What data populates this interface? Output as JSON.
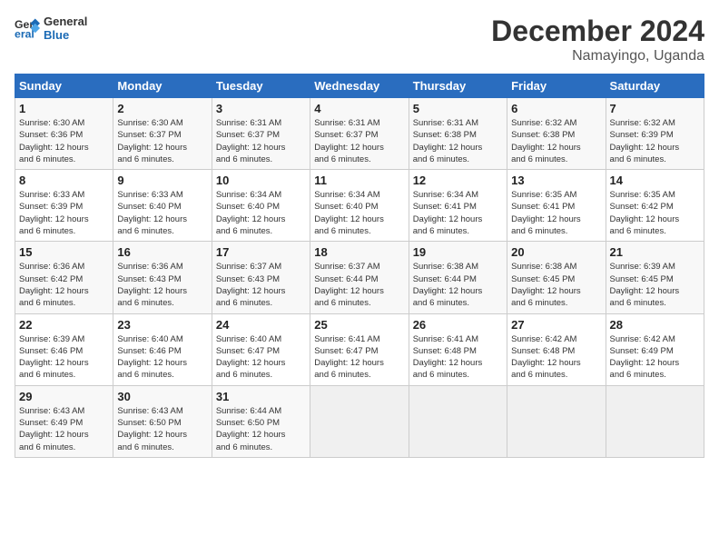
{
  "logo": {
    "line1": "General",
    "line2": "Blue"
  },
  "title": "December 2024",
  "subtitle": "Namayingo, Uganda",
  "days_of_week": [
    "Sunday",
    "Monday",
    "Tuesday",
    "Wednesday",
    "Thursday",
    "Friday",
    "Saturday"
  ],
  "weeks": [
    [
      {
        "day": "1",
        "sunrise": "6:30 AM",
        "sunset": "6:36 PM",
        "daylight": "12 hours and 6 minutes."
      },
      {
        "day": "2",
        "sunrise": "6:30 AM",
        "sunset": "6:37 PM",
        "daylight": "12 hours and 6 minutes."
      },
      {
        "day": "3",
        "sunrise": "6:31 AM",
        "sunset": "6:37 PM",
        "daylight": "12 hours and 6 minutes."
      },
      {
        "day": "4",
        "sunrise": "6:31 AM",
        "sunset": "6:37 PM",
        "daylight": "12 hours and 6 minutes."
      },
      {
        "day": "5",
        "sunrise": "6:31 AM",
        "sunset": "6:38 PM",
        "daylight": "12 hours and 6 minutes."
      },
      {
        "day": "6",
        "sunrise": "6:32 AM",
        "sunset": "6:38 PM",
        "daylight": "12 hours and 6 minutes."
      },
      {
        "day": "7",
        "sunrise": "6:32 AM",
        "sunset": "6:39 PM",
        "daylight": "12 hours and 6 minutes."
      }
    ],
    [
      {
        "day": "8",
        "sunrise": "6:33 AM",
        "sunset": "6:39 PM",
        "daylight": "12 hours and 6 minutes."
      },
      {
        "day": "9",
        "sunrise": "6:33 AM",
        "sunset": "6:40 PM",
        "daylight": "12 hours and 6 minutes."
      },
      {
        "day": "10",
        "sunrise": "6:34 AM",
        "sunset": "6:40 PM",
        "daylight": "12 hours and 6 minutes."
      },
      {
        "day": "11",
        "sunrise": "6:34 AM",
        "sunset": "6:40 PM",
        "daylight": "12 hours and 6 minutes."
      },
      {
        "day": "12",
        "sunrise": "6:34 AM",
        "sunset": "6:41 PM",
        "daylight": "12 hours and 6 minutes."
      },
      {
        "day": "13",
        "sunrise": "6:35 AM",
        "sunset": "6:41 PM",
        "daylight": "12 hours and 6 minutes."
      },
      {
        "day": "14",
        "sunrise": "6:35 AM",
        "sunset": "6:42 PM",
        "daylight": "12 hours and 6 minutes."
      }
    ],
    [
      {
        "day": "15",
        "sunrise": "6:36 AM",
        "sunset": "6:42 PM",
        "daylight": "12 hours and 6 minutes."
      },
      {
        "day": "16",
        "sunrise": "6:36 AM",
        "sunset": "6:43 PM",
        "daylight": "12 hours and 6 minutes."
      },
      {
        "day": "17",
        "sunrise": "6:37 AM",
        "sunset": "6:43 PM",
        "daylight": "12 hours and 6 minutes."
      },
      {
        "day": "18",
        "sunrise": "6:37 AM",
        "sunset": "6:44 PM",
        "daylight": "12 hours and 6 minutes."
      },
      {
        "day": "19",
        "sunrise": "6:38 AM",
        "sunset": "6:44 PM",
        "daylight": "12 hours and 6 minutes."
      },
      {
        "day": "20",
        "sunrise": "6:38 AM",
        "sunset": "6:45 PM",
        "daylight": "12 hours and 6 minutes."
      },
      {
        "day": "21",
        "sunrise": "6:39 AM",
        "sunset": "6:45 PM",
        "daylight": "12 hours and 6 minutes."
      }
    ],
    [
      {
        "day": "22",
        "sunrise": "6:39 AM",
        "sunset": "6:46 PM",
        "daylight": "12 hours and 6 minutes."
      },
      {
        "day": "23",
        "sunrise": "6:40 AM",
        "sunset": "6:46 PM",
        "daylight": "12 hours and 6 minutes."
      },
      {
        "day": "24",
        "sunrise": "6:40 AM",
        "sunset": "6:47 PM",
        "daylight": "12 hours and 6 minutes."
      },
      {
        "day": "25",
        "sunrise": "6:41 AM",
        "sunset": "6:47 PM",
        "daylight": "12 hours and 6 minutes."
      },
      {
        "day": "26",
        "sunrise": "6:41 AM",
        "sunset": "6:48 PM",
        "daylight": "12 hours and 6 minutes."
      },
      {
        "day": "27",
        "sunrise": "6:42 AM",
        "sunset": "6:48 PM",
        "daylight": "12 hours and 6 minutes."
      },
      {
        "day": "28",
        "sunrise": "6:42 AM",
        "sunset": "6:49 PM",
        "daylight": "12 hours and 6 minutes."
      }
    ],
    [
      {
        "day": "29",
        "sunrise": "6:43 AM",
        "sunset": "6:49 PM",
        "daylight": "12 hours and 6 minutes."
      },
      {
        "day": "30",
        "sunrise": "6:43 AM",
        "sunset": "6:50 PM",
        "daylight": "12 hours and 6 minutes."
      },
      {
        "day": "31",
        "sunrise": "6:44 AM",
        "sunset": "6:50 PM",
        "daylight": "12 hours and 6 minutes."
      },
      null,
      null,
      null,
      null
    ]
  ],
  "labels": {
    "sunrise": "Sunrise:",
    "sunset": "Sunset:",
    "daylight": "Daylight:"
  }
}
